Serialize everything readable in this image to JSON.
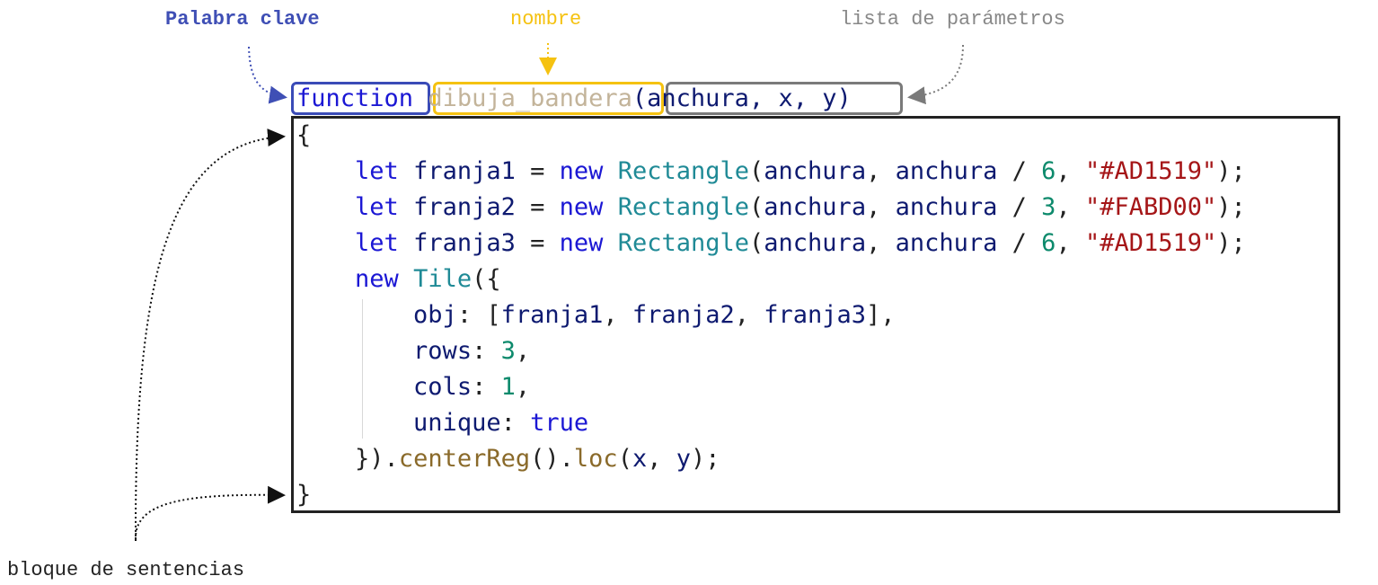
{
  "labels": {
    "keyword": "Palabra clave",
    "name": "nombre",
    "params": "lista de parámetros",
    "block": "bloque de sentencias"
  },
  "code": {
    "kw_function": "function",
    "name": "dibuja_bandera",
    "params": "(anchura, x, y)",
    "open_brace": "{",
    "close_brace": "}",
    "let": "let",
    "new": "new",
    "rectangle": "Rectangle",
    "tile": "Tile",
    "anchura": "anchura",
    "franja1": "franja1",
    "franja2": "franja2",
    "franja3": "franja3",
    "n6": "6",
    "n3": "3",
    "n1": "1",
    "c1": "\"#AD1519\"",
    "c2": "\"#FABD00\"",
    "obj": "obj",
    "rows": "rows",
    "cols": "cols",
    "unique": "unique",
    "true": "true",
    "centerReg": "centerReg",
    "loc": "loc",
    "x": "x",
    "y": "y"
  },
  "colors": {
    "keyword_label": "#3f4fb5",
    "name_label": "#f5c211",
    "params_label": "#888888"
  }
}
